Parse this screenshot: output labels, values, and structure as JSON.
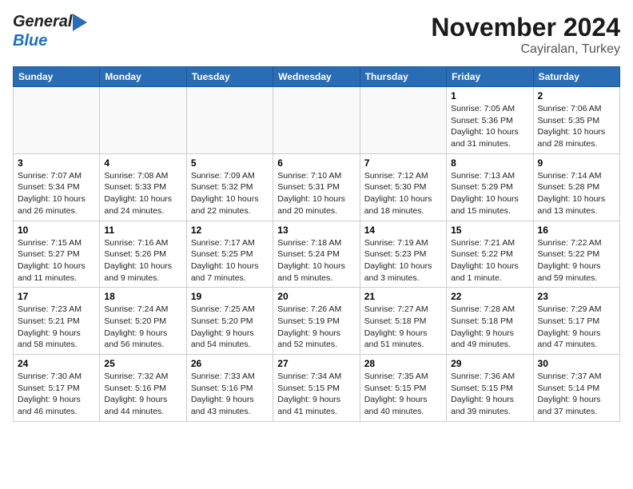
{
  "header": {
    "logo_line1": "General",
    "logo_line2": "Blue",
    "month": "November 2024",
    "location": "Cayiralan, Turkey"
  },
  "weekdays": [
    "Sunday",
    "Monday",
    "Tuesday",
    "Wednesday",
    "Thursday",
    "Friday",
    "Saturday"
  ],
  "weeks": [
    [
      {
        "day": "",
        "info": ""
      },
      {
        "day": "",
        "info": ""
      },
      {
        "day": "",
        "info": ""
      },
      {
        "day": "",
        "info": ""
      },
      {
        "day": "",
        "info": ""
      },
      {
        "day": "1",
        "info": "Sunrise: 7:05 AM\nSunset: 5:36 PM\nDaylight: 10 hours\nand 31 minutes."
      },
      {
        "day": "2",
        "info": "Sunrise: 7:06 AM\nSunset: 5:35 PM\nDaylight: 10 hours\nand 28 minutes."
      }
    ],
    [
      {
        "day": "3",
        "info": "Sunrise: 7:07 AM\nSunset: 5:34 PM\nDaylight: 10 hours\nand 26 minutes."
      },
      {
        "day": "4",
        "info": "Sunrise: 7:08 AM\nSunset: 5:33 PM\nDaylight: 10 hours\nand 24 minutes."
      },
      {
        "day": "5",
        "info": "Sunrise: 7:09 AM\nSunset: 5:32 PM\nDaylight: 10 hours\nand 22 minutes."
      },
      {
        "day": "6",
        "info": "Sunrise: 7:10 AM\nSunset: 5:31 PM\nDaylight: 10 hours\nand 20 minutes."
      },
      {
        "day": "7",
        "info": "Sunrise: 7:12 AM\nSunset: 5:30 PM\nDaylight: 10 hours\nand 18 minutes."
      },
      {
        "day": "8",
        "info": "Sunrise: 7:13 AM\nSunset: 5:29 PM\nDaylight: 10 hours\nand 15 minutes."
      },
      {
        "day": "9",
        "info": "Sunrise: 7:14 AM\nSunset: 5:28 PM\nDaylight: 10 hours\nand 13 minutes."
      }
    ],
    [
      {
        "day": "10",
        "info": "Sunrise: 7:15 AM\nSunset: 5:27 PM\nDaylight: 10 hours\nand 11 minutes."
      },
      {
        "day": "11",
        "info": "Sunrise: 7:16 AM\nSunset: 5:26 PM\nDaylight: 10 hours\nand 9 minutes."
      },
      {
        "day": "12",
        "info": "Sunrise: 7:17 AM\nSunset: 5:25 PM\nDaylight: 10 hours\nand 7 minutes."
      },
      {
        "day": "13",
        "info": "Sunrise: 7:18 AM\nSunset: 5:24 PM\nDaylight: 10 hours\nand 5 minutes."
      },
      {
        "day": "14",
        "info": "Sunrise: 7:19 AM\nSunset: 5:23 PM\nDaylight: 10 hours\nand 3 minutes."
      },
      {
        "day": "15",
        "info": "Sunrise: 7:21 AM\nSunset: 5:22 PM\nDaylight: 10 hours\nand 1 minute."
      },
      {
        "day": "16",
        "info": "Sunrise: 7:22 AM\nSunset: 5:22 PM\nDaylight: 9 hours\nand 59 minutes."
      }
    ],
    [
      {
        "day": "17",
        "info": "Sunrise: 7:23 AM\nSunset: 5:21 PM\nDaylight: 9 hours\nand 58 minutes."
      },
      {
        "day": "18",
        "info": "Sunrise: 7:24 AM\nSunset: 5:20 PM\nDaylight: 9 hours\nand 56 minutes."
      },
      {
        "day": "19",
        "info": "Sunrise: 7:25 AM\nSunset: 5:20 PM\nDaylight: 9 hours\nand 54 minutes."
      },
      {
        "day": "20",
        "info": "Sunrise: 7:26 AM\nSunset: 5:19 PM\nDaylight: 9 hours\nand 52 minutes."
      },
      {
        "day": "21",
        "info": "Sunrise: 7:27 AM\nSunset: 5:18 PM\nDaylight: 9 hours\nand 51 minutes."
      },
      {
        "day": "22",
        "info": "Sunrise: 7:28 AM\nSunset: 5:18 PM\nDaylight: 9 hours\nand 49 minutes."
      },
      {
        "day": "23",
        "info": "Sunrise: 7:29 AM\nSunset: 5:17 PM\nDaylight: 9 hours\nand 47 minutes."
      }
    ],
    [
      {
        "day": "24",
        "info": "Sunrise: 7:30 AM\nSunset: 5:17 PM\nDaylight: 9 hours\nand 46 minutes."
      },
      {
        "day": "25",
        "info": "Sunrise: 7:32 AM\nSunset: 5:16 PM\nDaylight: 9 hours\nand 44 minutes."
      },
      {
        "day": "26",
        "info": "Sunrise: 7:33 AM\nSunset: 5:16 PM\nDaylight: 9 hours\nand 43 minutes."
      },
      {
        "day": "27",
        "info": "Sunrise: 7:34 AM\nSunset: 5:15 PM\nDaylight: 9 hours\nand 41 minutes."
      },
      {
        "day": "28",
        "info": "Sunrise: 7:35 AM\nSunset: 5:15 PM\nDaylight: 9 hours\nand 40 minutes."
      },
      {
        "day": "29",
        "info": "Sunrise: 7:36 AM\nSunset: 5:15 PM\nDaylight: 9 hours\nand 39 minutes."
      },
      {
        "day": "30",
        "info": "Sunrise: 7:37 AM\nSunset: 5:14 PM\nDaylight: 9 hours\nand 37 minutes."
      }
    ]
  ]
}
